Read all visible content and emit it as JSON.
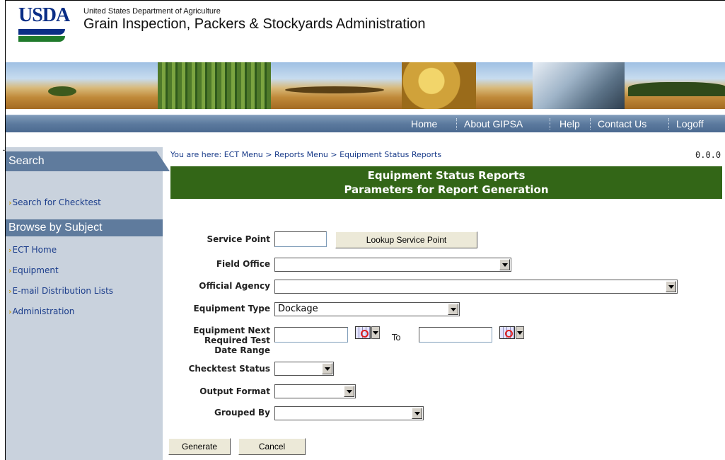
{
  "header": {
    "logo_text": "USDA",
    "department": "United States Department of Agriculture",
    "agency": "Grain Inspection, Packers & Stockyards Administration"
  },
  "nav": {
    "items": [
      {
        "label": "Home"
      },
      {
        "label": "About GIPSA"
      },
      {
        "label": "Help"
      },
      {
        "label": "Contact Us"
      },
      {
        "label": "Logoff"
      }
    ]
  },
  "sidebar": {
    "search_heading": "Search",
    "search_link": "Search for Checktest",
    "browse_heading": "Browse by Subject",
    "browse_links": [
      {
        "label": "ECT Home"
      },
      {
        "label": "Equipment"
      },
      {
        "label": "E-mail Distribution Lists"
      },
      {
        "label": "Administration"
      }
    ]
  },
  "main": {
    "breadcrumb": "You are here: ECT Menu > Reports Menu > Equipment Status Reports",
    "version": "0.0.0",
    "title_line1": "Equipment Status Reports",
    "title_line2": "Parameters for Report Generation"
  },
  "form": {
    "service_point_label": "Service Point",
    "service_point_value": "",
    "lookup_button": "Lookup Service Point",
    "field_office_label": "Field Office",
    "field_office_value": "",
    "official_agency_label": "Official Agency",
    "official_agency_value": "",
    "equipment_type_label": "Equipment Type",
    "equipment_type_value": "Dockage",
    "date_range_label_1": "Equipment Next",
    "date_range_label_2": "Required Test",
    "date_range_label_3": "Date Range",
    "date_from_value": "",
    "to_label": "To",
    "date_to_value": "",
    "checktest_status_label": "Checktest Status",
    "checktest_status_value": "",
    "output_format_label": "Output Format",
    "output_format_value": "",
    "grouped_by_label": "Grouped By",
    "grouped_by_value": "",
    "generate_button": "Generate",
    "cancel_button": "Cancel"
  },
  "icons": {
    "calendar": "calendar-icon",
    "arrow": "arrow-bullet-icon"
  },
  "colors": {
    "title_bar": "#336617",
    "nav_bar": "#5c7a9e",
    "sidebar_bg": "#c9d2dd",
    "sidebar_heading": "#5f7b9d",
    "link": "#1a3c8a"
  }
}
